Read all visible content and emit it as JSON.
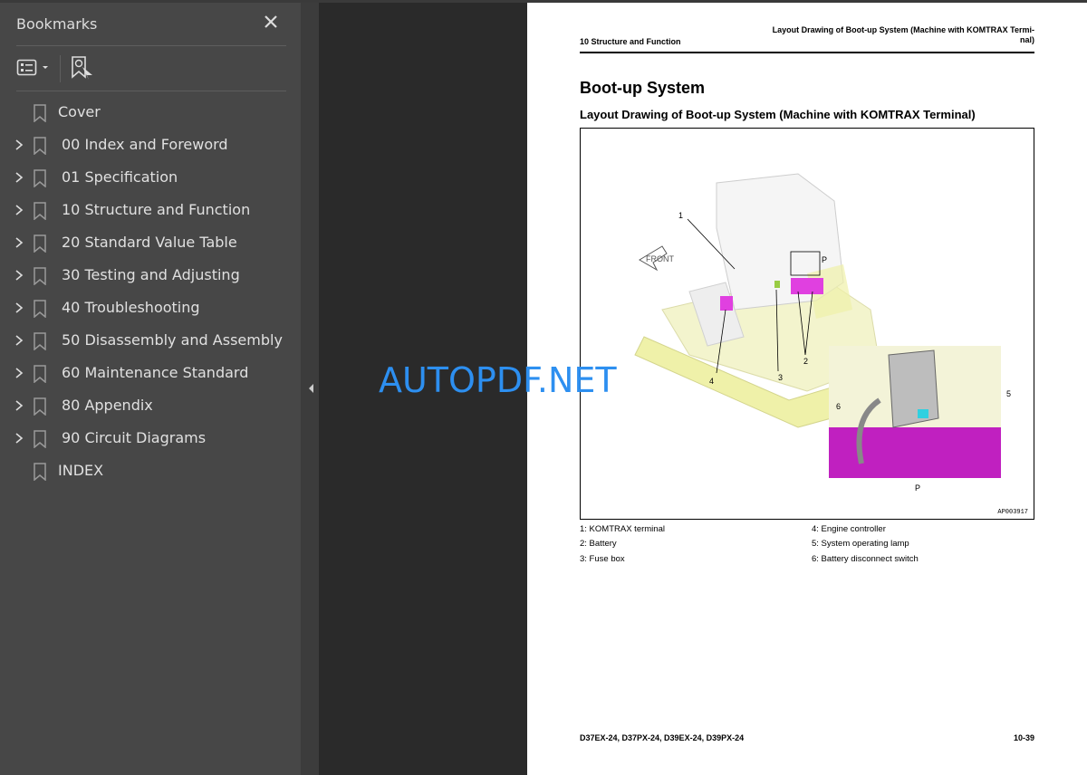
{
  "sidebar": {
    "title": "Bookmarks",
    "items": [
      {
        "label": "Cover",
        "expandable": false
      },
      {
        "label": "00 Index and Foreword",
        "expandable": true
      },
      {
        "label": "01 Specification",
        "expandable": true
      },
      {
        "label": "10 Structure and Function",
        "expandable": true
      },
      {
        "label": "20 Standard Value Table",
        "expandable": true
      },
      {
        "label": "30 Testing and Adjusting",
        "expandable": true
      },
      {
        "label": "40 Troubleshooting",
        "expandable": true
      },
      {
        "label": "50 Disassembly and Assembly",
        "expandable": true
      },
      {
        "label": "60 Maintenance Standard",
        "expandable": true
      },
      {
        "label": "80 Appendix",
        "expandable": true
      },
      {
        "label": "90 Circuit Diagrams",
        "expandable": true
      },
      {
        "label": "INDEX",
        "expandable": false
      }
    ]
  },
  "page": {
    "header_left": "10 Structure and Function",
    "header_right_line1": "Layout Drawing of Boot-up System (Machine with KOMTRAX Termi-",
    "header_right_line2": "nal)",
    "title": "Boot-up System",
    "subtitle": "Layout Drawing of Boot-up System (Machine with KOMTRAX Terminal)",
    "figure": {
      "id": "AP003917",
      "callouts": [
        "1",
        "2",
        "3",
        "4",
        "5",
        "6",
        "P"
      ],
      "detail_label": "P",
      "front_label": "FRONT"
    },
    "legend_left": [
      "1: KOMTRAX terminal",
      "2: Battery",
      "3: Fuse box"
    ],
    "legend_right": [
      "4: Engine controller",
      "5: System operating lamp",
      "6: Battery disconnect switch"
    ],
    "footer_models": "D37EX-24, D37PX-24, D39EX-24, D39PX-24",
    "footer_page": "10-39"
  },
  "watermark": "AUTOPDF.NET",
  "colors": {
    "sidebar_bg": "#474747",
    "viewer_bg": "#2a2a2a",
    "watermark": "#2d8ff0",
    "machine_yellow": "#eef0a0",
    "component_magenta": "#e040e0",
    "lamp_cyan": "#30d0e0"
  }
}
